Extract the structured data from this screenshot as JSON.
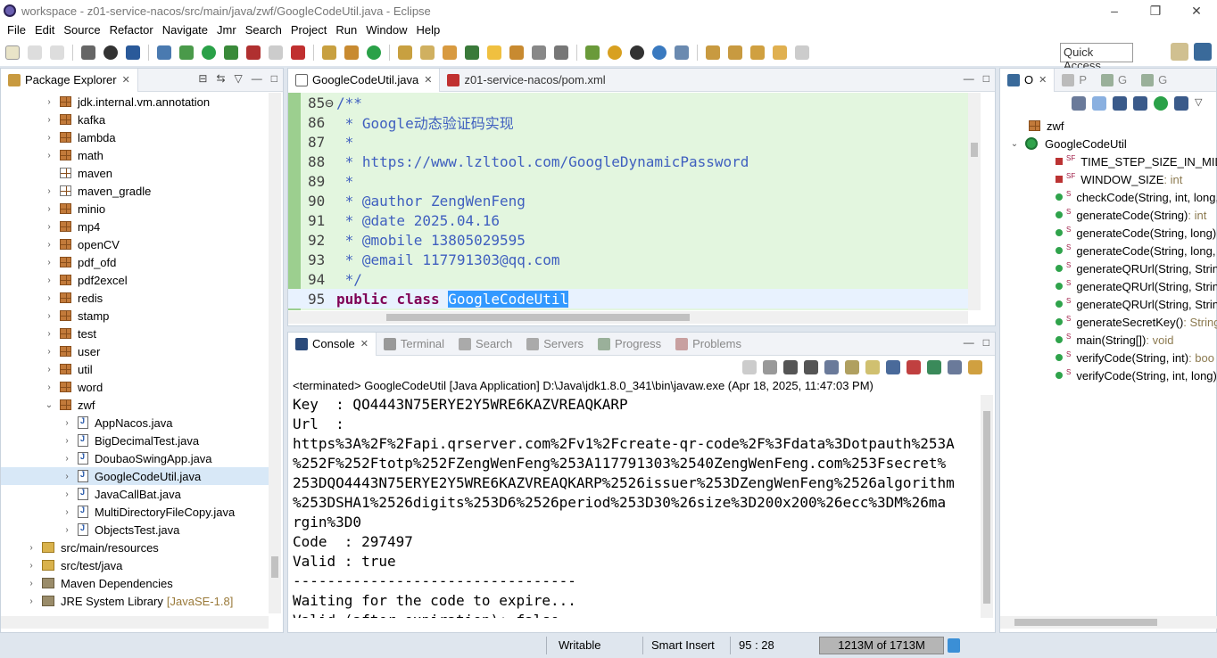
{
  "window": {
    "title": "workspace - z01-service-nacos/src/main/java/zwf/GoogleCodeUtil.java - Eclipse",
    "minimize": "–",
    "maximize": "❐",
    "close": "✕"
  },
  "menu": [
    "File",
    "Edit",
    "Source",
    "Refactor",
    "Navigate",
    "Jmr",
    "Search",
    "Project",
    "Run",
    "Window",
    "Help"
  ],
  "quick_access": "Quick Access",
  "package_explorer": {
    "tab_label": "Package Explorer",
    "rows": [
      {
        "label": "jdk.internal.vm.annotation",
        "indent": 1,
        "icon": "package",
        "expand": "collapsed"
      },
      {
        "label": "kafka",
        "indent": 1,
        "icon": "package",
        "expand": "collapsed"
      },
      {
        "label": "lambda",
        "indent": 1,
        "icon": "package",
        "expand": "collapsed"
      },
      {
        "label": "math",
        "indent": 1,
        "icon": "package",
        "expand": "collapsed"
      },
      {
        "label": "maven",
        "indent": 1,
        "icon": "package-empty",
        "expand": "none"
      },
      {
        "label": "maven_gradle",
        "indent": 1,
        "icon": "package-empty",
        "expand": "collapsed"
      },
      {
        "label": "minio",
        "indent": 1,
        "icon": "package",
        "expand": "collapsed"
      },
      {
        "label": "mp4",
        "indent": 1,
        "icon": "package",
        "expand": "collapsed"
      },
      {
        "label": "openCV",
        "indent": 1,
        "icon": "package",
        "expand": "collapsed"
      },
      {
        "label": "pdf_ofd",
        "indent": 1,
        "icon": "package",
        "expand": "collapsed"
      },
      {
        "label": "pdf2excel",
        "indent": 1,
        "icon": "package",
        "expand": "collapsed"
      },
      {
        "label": "redis",
        "indent": 1,
        "icon": "package",
        "expand": "collapsed"
      },
      {
        "label": "stamp",
        "indent": 1,
        "icon": "package",
        "expand": "collapsed"
      },
      {
        "label": "test",
        "indent": 1,
        "icon": "package",
        "expand": "collapsed"
      },
      {
        "label": "user",
        "indent": 1,
        "icon": "package",
        "expand": "collapsed"
      },
      {
        "label": "util",
        "indent": 1,
        "icon": "package",
        "expand": "collapsed"
      },
      {
        "label": "word",
        "indent": 1,
        "icon": "package",
        "expand": "collapsed"
      },
      {
        "label": "zwf",
        "indent": 1,
        "icon": "package",
        "expand": "expanded"
      },
      {
        "label": "AppNacos.java",
        "indent": 2,
        "icon": "java-file",
        "expand": "collapsed"
      },
      {
        "label": "BigDecimalTest.java",
        "indent": 2,
        "icon": "java-file",
        "expand": "collapsed"
      },
      {
        "label": "DoubaoSwingApp.java",
        "indent": 2,
        "icon": "java-file",
        "expand": "collapsed"
      },
      {
        "label": "GoogleCodeUtil.java",
        "indent": 2,
        "icon": "java-file",
        "expand": "collapsed",
        "selected": true
      },
      {
        "label": "JavaCallBat.java",
        "indent": 2,
        "icon": "java-file",
        "expand": "collapsed"
      },
      {
        "label": "MultiDirectoryFileCopy.java",
        "indent": 2,
        "icon": "java-file",
        "expand": "collapsed"
      },
      {
        "label": "ObjectsTest.java",
        "indent": 2,
        "icon": "java-file",
        "expand": "collapsed"
      },
      {
        "label": "src/main/resources",
        "indent": 0,
        "icon": "folder",
        "expand": "collapsed"
      },
      {
        "label": "src/test/java",
        "indent": 0,
        "icon": "folder",
        "expand": "collapsed"
      },
      {
        "label": "Maven Dependencies",
        "indent": 0,
        "icon": "library",
        "expand": "collapsed"
      },
      {
        "label": "JRE System Library",
        "suffix": "[JavaSE-1.8]",
        "indent": 0,
        "icon": "library",
        "expand": "collapsed"
      }
    ]
  },
  "editor": {
    "tabs": [
      {
        "label": "GoogleCodeUtil.java",
        "active": true
      },
      {
        "label": "z01-service-nacos/pom.xml",
        "active": false
      }
    ],
    "lines": [
      {
        "n": "85⊖",
        "text": "/**"
      },
      {
        "n": "86",
        "text": " * Google动态验证码实现"
      },
      {
        "n": "87",
        "text": " *"
      },
      {
        "n": "88",
        "text": " * https://www.lzltool.com/GoogleDynamicPassword"
      },
      {
        "n": "89",
        "text": " *"
      },
      {
        "n": "90",
        "text": " * @author ZengWenFeng"
      },
      {
        "n": "91",
        "text": " * @date 2025.04.16"
      },
      {
        "n": "92",
        "text": " * @mobile 13805029595"
      },
      {
        "n": "93",
        "text": " * @email 117791303@qq.com"
      },
      {
        "n": "94",
        "text": " */"
      }
    ],
    "last_line": {
      "n": "95",
      "kw1": "public",
      "kw2": "class",
      "name": "GoogleCodeUtil"
    }
  },
  "console": {
    "tabs": [
      "Console",
      "Terminal",
      "Search",
      "Servers",
      "Progress",
      "Problems"
    ],
    "header": "<terminated> GoogleCodeUtil [Java Application] D:\\Java\\jdk1.8.0_341\\bin\\javaw.exe (Apr 18, 2025, 11:47:03 PM)",
    "output": [
      "Key  : QO4443N75ERYE2Y5WRE6KAZVREAQKARP",
      "Url  :",
      "https%3A%2F%2Fapi.qrserver.com%2Fv1%2Fcreate-qr-code%2F%3Fdata%3Dotpauth%253A",
      "%252F%252Ftotp%252FZengWenFeng%253A117791303%2540ZengWenFeng.com%253Fsecret%",
      "253DQO4443N75ERYE2Y5WRE6KAZVREAQKARP%2526issuer%253DZengWenFeng%2526algorithm",
      "%253DSHA1%2526digits%253D6%2526period%253D30%26size%3D200x200%26ecc%3DM%26ma",
      "rgin%3D0",
      "Code  : 297497",
      "Valid : true",
      "---------------------------------",
      "Waiting for the code to expire...",
      "Valid (after expiration): false"
    ]
  },
  "outline": {
    "tabs": [
      "O",
      "P",
      "G",
      "G"
    ],
    "package": "zwf",
    "class": "GoogleCodeUtil",
    "members": [
      {
        "name": "TIME_STEP_SIZE_IN_MILLIS",
        "type": "",
        "kind": "field",
        "mod": "SF"
      },
      {
        "name": "WINDOW_SIZE",
        "type": " : int",
        "kind": "field",
        "mod": "SF"
      },
      {
        "name": "checkCode(String, int, long,",
        "type": "",
        "kind": "method",
        "mod": "S"
      },
      {
        "name": "generateCode(String)",
        "type": " : int",
        "kind": "method",
        "mod": "S"
      },
      {
        "name": "generateCode(String, long)",
        "type": "",
        "kind": "method",
        "mod": "S"
      },
      {
        "name": "generateCode(String, long,",
        "type": "",
        "kind": "method",
        "mod": "S"
      },
      {
        "name": "generateQRUrl(String, Strin",
        "type": "",
        "kind": "method",
        "mod": "S"
      },
      {
        "name": "generateQRUrl(String, Strin",
        "type": "",
        "kind": "method",
        "mod": "S"
      },
      {
        "name": "generateQRUrl(String, Strin",
        "type": "",
        "kind": "method",
        "mod": "S"
      },
      {
        "name": "generateSecretKey()",
        "type": " : String",
        "kind": "method",
        "mod": "S"
      },
      {
        "name": "main(String[])",
        "type": " : void",
        "kind": "method",
        "mod": "S"
      },
      {
        "name": "verifyCode(String, int)",
        "type": " : boo",
        "kind": "method",
        "mod": "S"
      },
      {
        "name": "verifyCode(String, int, long)",
        "type": "",
        "kind": "method",
        "mod": "S"
      }
    ]
  },
  "status": {
    "writable": "Writable",
    "insert_mode": "Smart Insert",
    "position": "95 : 28",
    "heap": "1213M of 1713M"
  }
}
